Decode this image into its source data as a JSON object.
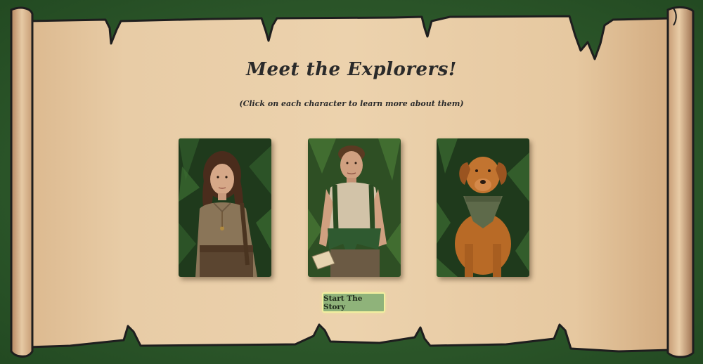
{
  "scroll": {
    "title": "Meet the Explorers!",
    "subtitle": "(Click on each character to learn more about them)"
  },
  "characters": [
    {
      "id": "woman-explorer",
      "icon": "woman-explorer-portrait"
    },
    {
      "id": "man-explorer",
      "icon": "man-explorer-portrait"
    },
    {
      "id": "dog-companion",
      "icon": "dog-portrait"
    }
  ],
  "actions": {
    "start_label": "Start The Story"
  },
  "colors": {
    "jungle_green": "#2d5a2c",
    "parchment": "#e6c8a0",
    "button_bg": "#8fb37a",
    "button_border": "#f2f0a0"
  }
}
